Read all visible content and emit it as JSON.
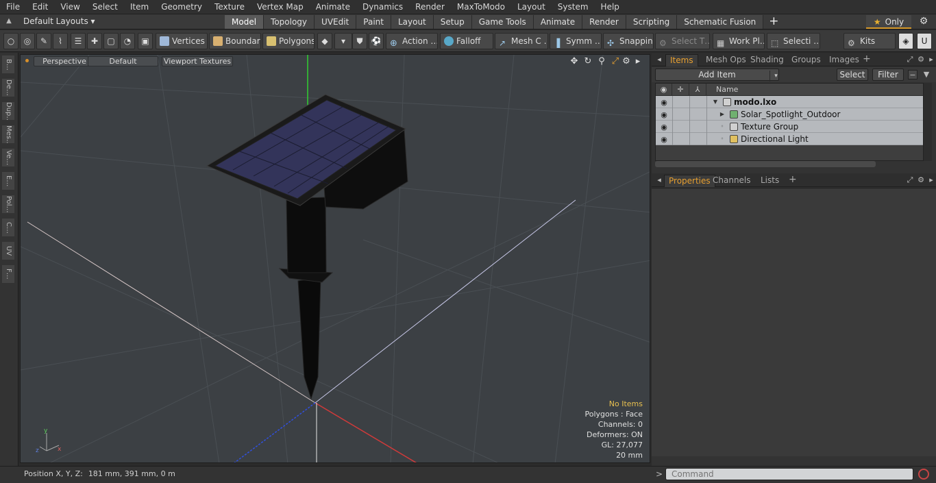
{
  "menu": [
    "File",
    "Edit",
    "View",
    "Select",
    "Item",
    "Geometry",
    "Texture",
    "Vertex Map",
    "Animate",
    "Dynamics",
    "Render",
    "MaxToModo",
    "Layout",
    "System",
    "Help"
  ],
  "layout": {
    "label": "Default Layouts ▾"
  },
  "tabs": [
    {
      "label": "Model",
      "active": true
    },
    {
      "label": "Topology"
    },
    {
      "label": "UVEdit"
    },
    {
      "label": "Paint"
    },
    {
      "label": "Layout"
    },
    {
      "label": "Setup"
    },
    {
      "label": "Game Tools"
    },
    {
      "label": "Animate"
    },
    {
      "label": "Render"
    },
    {
      "label": "Scripting"
    },
    {
      "label": "Schematic Fusion"
    }
  ],
  "tabs_plus": "+",
  "only": "Only",
  "toolbar": {
    "vertices": "Vertices",
    "boundary": "Boundary",
    "polygons": "Polygons",
    "action": "Action",
    "action_more": "…",
    "falloff": "Falloff",
    "mesh": "Mesh C …",
    "symm": "Symm …",
    "snapping": "Snapping",
    "select_t": "Select T…",
    "work_plane": "Work Pl…",
    "selecti": "Selecti …",
    "kits": "Kits"
  },
  "left_strip": [
    "B…",
    "De…",
    "Dup…",
    "Mes…",
    "Ve…",
    "E…",
    "Pol…",
    "C…",
    "UV",
    "F…"
  ],
  "viewport": {
    "perspective": "Perspective",
    "default": "Default",
    "textures": "Viewport Textures",
    "info": {
      "no_items": "No Items",
      "polygons": "Polygons : Face",
      "channels": "Channels: 0",
      "deformers": "Deformers: ON",
      "gl": "GL: 27,077",
      "scale": "20 mm"
    }
  },
  "items_panel": {
    "tabs": [
      "Items",
      "Mesh Ops",
      "Shading",
      "Groups",
      "Images"
    ],
    "plus": "+",
    "add_item": "Add Item",
    "select": "Select",
    "filter": "Filter",
    "name_header": "Name",
    "rows": [
      {
        "label": "modo.lxo",
        "level": 0,
        "expander": "▼"
      },
      {
        "label": "Solar_Spotlight_Outdoor",
        "level": 1,
        "expander": "▶"
      },
      {
        "label": "Texture Group",
        "level": 1,
        "expander": "◦"
      },
      {
        "label": "Directional Light",
        "level": 1,
        "expander": "◦"
      }
    ]
  },
  "properties_panel": {
    "tabs": [
      "Properties",
      "Channels",
      "Lists"
    ],
    "plus": "+"
  },
  "command": {
    "prompt": ">",
    "placeholder": "Command"
  },
  "status": {
    "label": "Position X, Y, Z:",
    "values": "181 mm, 391 mm, 0 m"
  },
  "colors": {
    "accent": "#e8a030",
    "viewport_bg": "#3c4044",
    "axis_x": "#d04040",
    "axis_y": "#40c040",
    "axis_z": "#4060d0"
  }
}
